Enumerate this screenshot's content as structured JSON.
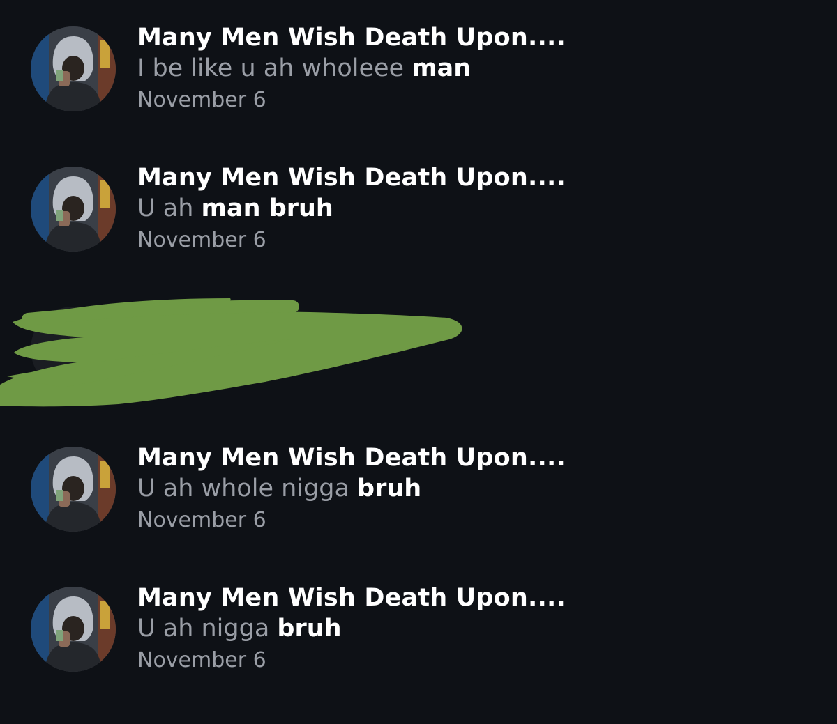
{
  "colors": {
    "background": "#0e1116",
    "title": "#ffffff",
    "preview_muted": "#9a9ea6",
    "highlight": "#ffffff",
    "scribble": "#6f9a45"
  },
  "messages": [
    {
      "title": "Many Men Wish Death Upon....",
      "preview_plain": "I be like u ah wholeee ",
      "preview_bold": "man",
      "date": "November 6",
      "avatar": "avatar-hooded-person"
    },
    {
      "title": "Many Men Wish Death Upon....",
      "preview_plain": "U ah ",
      "preview_bold": "man bruh",
      "date": "November 6",
      "avatar": "avatar-hooded-person"
    },
    {
      "title": "",
      "preview_plain": "",
      "preview_bold": "",
      "date": "",
      "avatar": "redacted",
      "redacted": true
    },
    {
      "title": "Many Men Wish Death Upon....",
      "preview_plain": "U ah whole nigga ",
      "preview_bold": "bruh",
      "date": "November 6",
      "avatar": "avatar-hooded-person"
    },
    {
      "title": "Many Men Wish Death Upon....",
      "preview_plain": "U ah nigga ",
      "preview_bold": "bruh",
      "date": "November 6",
      "avatar": "avatar-hooded-person"
    }
  ]
}
